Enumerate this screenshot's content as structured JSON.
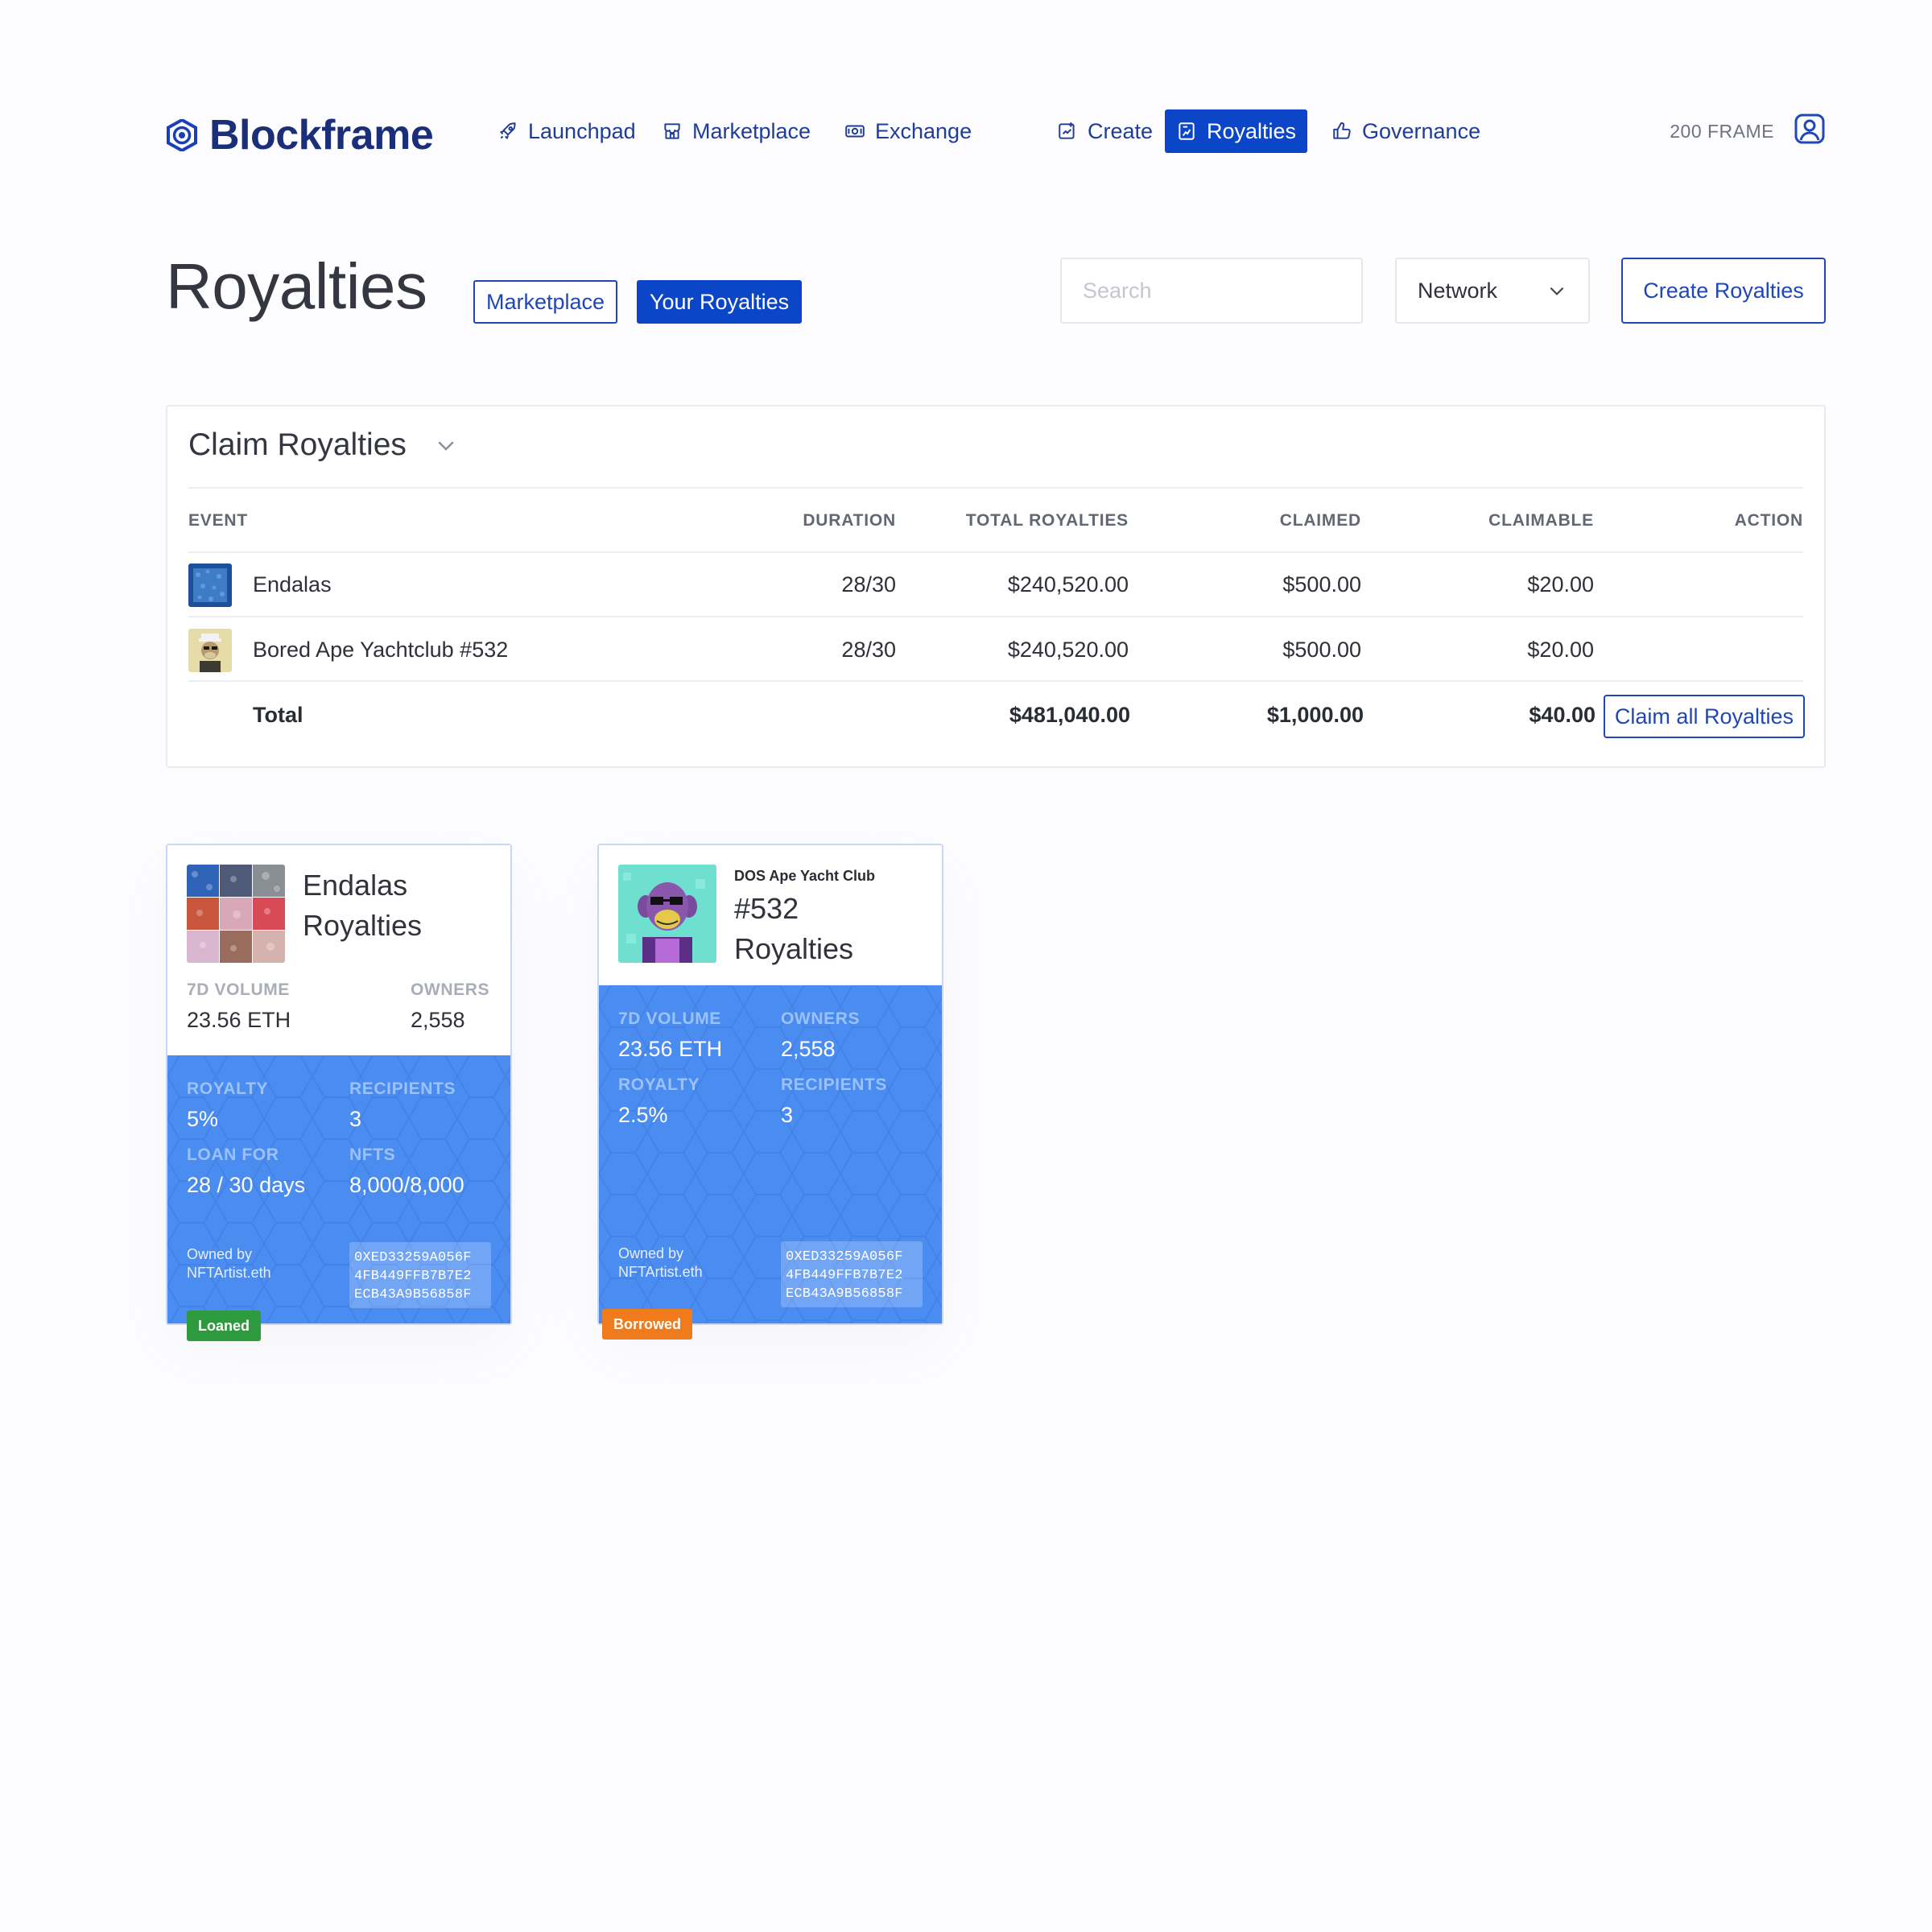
{
  "brand": {
    "name": "Blockframe",
    "color": "#1a2f78"
  },
  "nav": {
    "items": [
      {
        "label": "Launchpad",
        "icon": "rocket-icon"
      },
      {
        "label": "Marketplace",
        "icon": "storefront-icon"
      },
      {
        "label": "Exchange",
        "icon": "exchange-icon"
      },
      {
        "label": "Create",
        "icon": "create-icon"
      },
      {
        "label": "Royalties",
        "icon": "royalties-icon",
        "active": true
      },
      {
        "label": "Governance",
        "icon": "thumbs-up-icon"
      }
    ],
    "balance": "200 FRAME",
    "account_icon": "user-avatar-icon"
  },
  "header": {
    "title": "Royalties",
    "tabs": [
      {
        "label": "Marketplace",
        "active": false
      },
      {
        "label": "Your Royalties",
        "active": true
      }
    ],
    "search_placeholder": "Search",
    "network_label": "Network",
    "create_label": "Create Royalties"
  },
  "claim": {
    "title": "Claim Royalties",
    "columns": [
      "EVENT",
      "DURATION",
      "TOTAL ROYALTIES",
      "CLAIMED",
      "CLAIMABLE",
      "ACTION"
    ],
    "rows": [
      {
        "event": "Endalas",
        "duration": "28/30",
        "total": "$240,520.00",
        "claimed": "$500.00",
        "claimable": "$20.00"
      },
      {
        "event": "Bored Ape Yachtclub #532",
        "duration": "28/30",
        "total": "$240,520.00",
        "claimed": "$500.00",
        "claimable": "$20.00"
      }
    ],
    "total": {
      "label": "Total",
      "total": "$481,040.00",
      "claimed": "$1,000.00",
      "claimable": "$40.00"
    },
    "claim_all_label": "Claim all Royalties"
  },
  "cards": [
    {
      "title_line1": "Endalas",
      "title_line2": "Royalties",
      "volume_label": "7D VOLUME",
      "volume": "23.56 ETH",
      "owners_label": "OWNERS",
      "owners": "2,558",
      "royalty_label": "ROYALTY",
      "royalty": "5%",
      "recipients_label": "RECIPIENTS",
      "recipients": "3",
      "loan_label": "LOAN FOR",
      "loan": "28 / 30 days",
      "nfts_label": "NFTS",
      "nfts": "8,000/8,000",
      "owned_by_label": "Owned by",
      "owner": "NFTArtist.eth",
      "address": [
        "0XED33259A056F",
        "4FB449FFB7B7E2",
        "ECB43A9B56858F"
      ],
      "badge": "Loaned",
      "badge_color": "#2e9a3e"
    },
    {
      "collection": "DOS Ape Yacht Club",
      "title_line1": "#532",
      "title_line2": "Royalties",
      "volume_label": "7D VOLUME",
      "volume": "23.56 ETH",
      "owners_label": "OWNERS",
      "owners": "2,558",
      "royalty_label": "ROYALTY",
      "royalty": "2.5%",
      "recipients_label": "RECIPIENTS",
      "recipients": "3",
      "owned_by_label": "Owned by",
      "owner": "NFTArtist.eth",
      "address": [
        "0XED33259A056F",
        "4FB449FFB7B7E2",
        "ECB43A9B56858F"
      ],
      "badge": "Borrowed",
      "badge_color": "#f07b1c"
    }
  ],
  "colors": {
    "accent": "#0b46c9",
    "card_blue": "#4b8cf1"
  }
}
